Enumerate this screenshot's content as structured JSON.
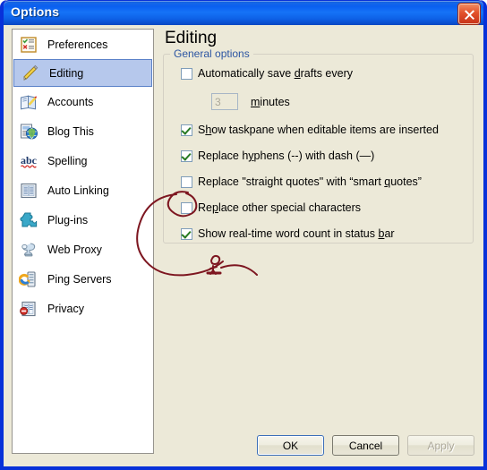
{
  "window": {
    "title": "Options",
    "close_label": "Close"
  },
  "sidebar": {
    "items": [
      {
        "label": "Preferences",
        "icon": "preferences-checklist-icon",
        "selected": false
      },
      {
        "label": "Editing",
        "icon": "pencil-icon",
        "selected": true
      },
      {
        "label": "Accounts",
        "icon": "book-pencil-icon",
        "selected": false
      },
      {
        "label": "Blog This",
        "icon": "page-globe-icon",
        "selected": false
      },
      {
        "label": "Spelling",
        "icon": "abc-spellcheck-icon",
        "selected": false
      },
      {
        "label": "Auto Linking",
        "icon": "document-lines-icon",
        "selected": false
      },
      {
        "label": "Plug-ins",
        "icon": "puzzle-piece-icon",
        "selected": false
      },
      {
        "label": "Web Proxy",
        "icon": "faucet-icon",
        "selected": false
      },
      {
        "label": "Ping Servers",
        "icon": "server-refresh-icon",
        "selected": false
      },
      {
        "label": "Privacy",
        "icon": "document-block-icon",
        "selected": false
      }
    ]
  },
  "pane": {
    "title": "Editing",
    "group": {
      "legend": "General options",
      "options": [
        {
          "pre": "Automatically save ",
          "accel": "d",
          "post": "rafts every",
          "checked": false,
          "name": "auto-save-drafts"
        },
        {
          "pre": "S",
          "accel": "h",
          "post": "ow taskpane when editable items are inserted",
          "checked": true,
          "name": "show-taskpane"
        },
        {
          "pre": "Replace h",
          "accel": "y",
          "post": "phens (--) with dash (—)",
          "checked": true,
          "name": "replace-hyphens"
        },
        {
          "pre": "Replace \"straight quotes\" with “smart ",
          "accel": "q",
          "post": "uotes”",
          "checked": false,
          "name": "replace-straight-quotes"
        },
        {
          "pre": "Re",
          "accel": "p",
          "post": "lace other special characters",
          "checked": false,
          "name": "replace-special-characters"
        },
        {
          "pre": "Show real-time word count in status ",
          "accel": "b",
          "post": "ar",
          "checked": true,
          "name": "show-word-count"
        }
      ],
      "minutes": {
        "value": "3",
        "placeholder": "3",
        "label_pre": "",
        "label_accel": "m",
        "label_post": "inutes",
        "enabled": false
      }
    }
  },
  "buttons": {
    "ok": "OK",
    "cancel": "Cancel",
    "apply": "Apply"
  },
  "colors": {
    "titlebar_blue": "#0a5ff0",
    "window_border": "#0831d9",
    "dialog_face": "#ece9d8",
    "selection": "#b6c8ec",
    "legend_text": "#2c55a2",
    "check_green": "#277a22",
    "annotation_red": "#7d1620"
  },
  "annotation": {
    "present": true,
    "description": "hand-drawn dark red ellipse around the 'Replace other special characters' checkbox with a long trailing curve and a small stick figure squiggle"
  }
}
